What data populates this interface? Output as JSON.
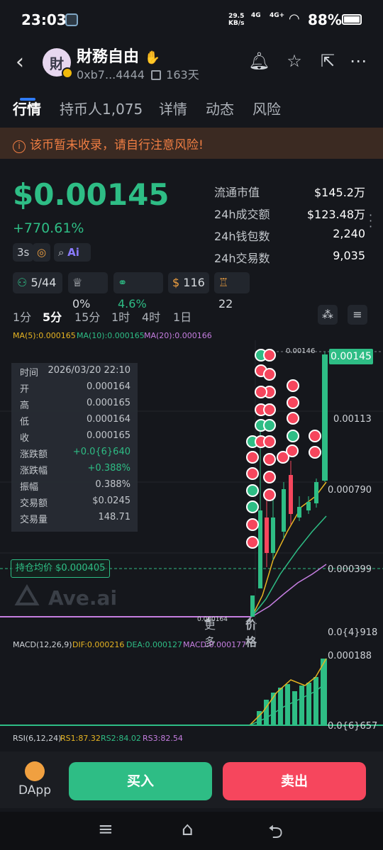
{
  "status_bar": {
    "time": "23:03",
    "net_speed": "29.5",
    "net_unit": "KB/s",
    "sig1": "4G",
    "sig2": "4G+",
    "battery": "88%"
  },
  "header": {
    "title": "財務自由",
    "hand_icon": "✋",
    "avatar_char": "財",
    "address": "0xb7...4444",
    "age": "163天"
  },
  "tabs": [
    "行情",
    "持币人1,075",
    "详情",
    "动态",
    "风险"
  ],
  "warning": "该币暂未收录，请自行注意风险!",
  "price": {
    "value": "$0.00145",
    "change": "+770.61%"
  },
  "chips": [
    "3s"
  ],
  "stats": [
    {
      "k": "流通市值",
      "v": "$145.2万"
    },
    {
      "k": "24h成交额",
      "v": "$123.48万"
    },
    {
      "k": "24h钱包数",
      "v": "2,240"
    },
    {
      "k": "24h交易数",
      "v": "9,035"
    }
  ],
  "badges": [
    "5/44",
    "0%",
    "4.6%",
    "116",
    "22"
  ],
  "timeframes": [
    "1分",
    "5分",
    "15分",
    "1时",
    "4时",
    "1日",
    "更多",
    "价格"
  ],
  "ma": {
    "ma5": "MA(5):0.000165",
    "ma10": "MA(10):0.000165",
    "ma20": "MA(20):0.000166"
  },
  "ohlc": [
    {
      "l": "时间",
      "r": "2026/03/20 22:10"
    },
    {
      "l": "开",
      "r": "0.000164"
    },
    {
      "l": "高",
      "r": "0.000165"
    },
    {
      "l": "低",
      "r": "0.000164"
    },
    {
      "l": "收",
      "r": "0.000165"
    },
    {
      "l": "涨跌额",
      "r": "+0.0{6}640"
    },
    {
      "l": "涨跌幅",
      "r": "+0.388%"
    },
    {
      "l": "振幅",
      "r": "0.388%"
    },
    {
      "l": "交易额",
      "r": "$0.0245"
    },
    {
      "l": "交易量",
      "r": "148.71"
    }
  ],
  "avg_hold": "持仓均价 $0.000405",
  "watermark": "Ave.ai",
  "y_axis": {
    "top": "0.00146",
    "last": "0.00145",
    "p1": "0.00113",
    "p2": "0.000790",
    "p3": "0.000399",
    "low": "0.0{4}918",
    "min_label": "0.000164"
  },
  "macd": {
    "label": "MACD(12,26,9)",
    "dif": "DIF:0.000216",
    "dea": "DEA:0.000127",
    "macd": "MACD:0.000177",
    "y_top": "0.000188",
    "y_bot": "0.0{6}657"
  },
  "rsi": {
    "label": "RSI(6,12,24)",
    "r1": "RS1:87.32",
    "r2": "RS2:84.02",
    "r3": "RS3:82.54"
  },
  "bottom": {
    "dapp": "DApp",
    "buy": "买入",
    "sell": "卖出"
  },
  "colors": {
    "up": "#2ebd85",
    "down": "#f6465d",
    "accent": "#2f7bf6",
    "ma5": "#e6b422",
    "ma10": "#2ebd85",
    "ma20": "#c57ee0"
  }
}
